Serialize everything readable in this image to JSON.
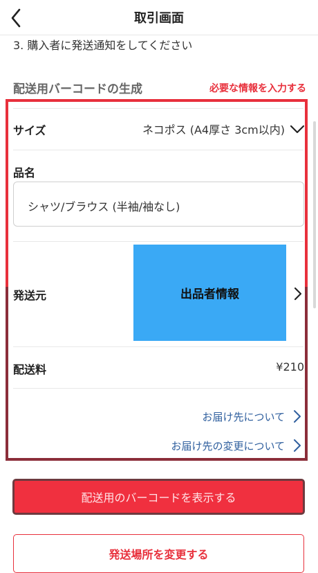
{
  "header": {
    "title": "取引画面"
  },
  "step_text": "3. 購入者に発送通知をしてください",
  "section": {
    "title": "配送用バーコードの生成",
    "required_note": "必要な情報を入力する"
  },
  "form": {
    "size_label": "サイズ",
    "size_value": "ネコポス (A4厚さ 3cm以内)",
    "item_label": "品名",
    "item_value": "シャツ/ブラウス (半袖/袖なし)",
    "origin_label": "発送元",
    "origin_button": "出品者情報",
    "fee_label": "配送料",
    "fee_value": "¥210",
    "link_delivery": "お届け先について",
    "link_change": "お届け先の変更について"
  },
  "buttons": {
    "show_barcode": "配送用のバーコードを表示する",
    "change_location": "発送場所を変更する"
  },
  "colors": {
    "accent": "#e8303c",
    "highlight_blue": "#3aa9f5",
    "link": "#2f5f9e"
  },
  "icons": [
    "back-arrow-icon",
    "chevron-down-icon",
    "chevron-right-icon"
  ]
}
